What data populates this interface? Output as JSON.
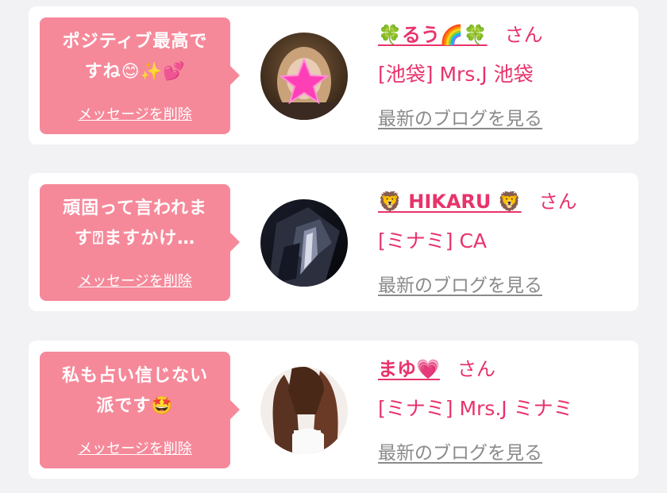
{
  "messages": [
    {
      "text": "ポジティブ最高で\nすね😊✨💕",
      "delete_label": "メッセージを削除",
      "avatar_icon": "blurred-portrait-with-star-sticker",
      "name": "🍀るう🌈🍀",
      "honorific": "さん",
      "shop": "[池袋] Mrs.J 池袋",
      "blog_label": "最新のブログを見る"
    },
    {
      "text": "頑固って言われま\nす⍰ますかけ…",
      "delete_label": "メッセージを削除",
      "avatar_icon": "dark-suit-portrait",
      "name": "🦁 HIKARU 🦁",
      "honorific": "さん",
      "shop": "[ミナミ] CA",
      "blog_label": "最新のブログを見る"
    },
    {
      "text": "私も占い信じない\n派です🤩",
      "delete_label": "メッセージを削除",
      "avatar_icon": "long-hair-portrait",
      "name": "まゆ💗",
      "honorific": "さん",
      "shop": "[ミナミ] Mrs.J ミナミ",
      "blog_label": "最新のブログを見る"
    }
  ],
  "colors": {
    "bubble": "#f5899a",
    "accent": "#e8336b",
    "link_gray": "#8a8a8a",
    "background": "#f2f2f4",
    "card": "#ffffff"
  }
}
